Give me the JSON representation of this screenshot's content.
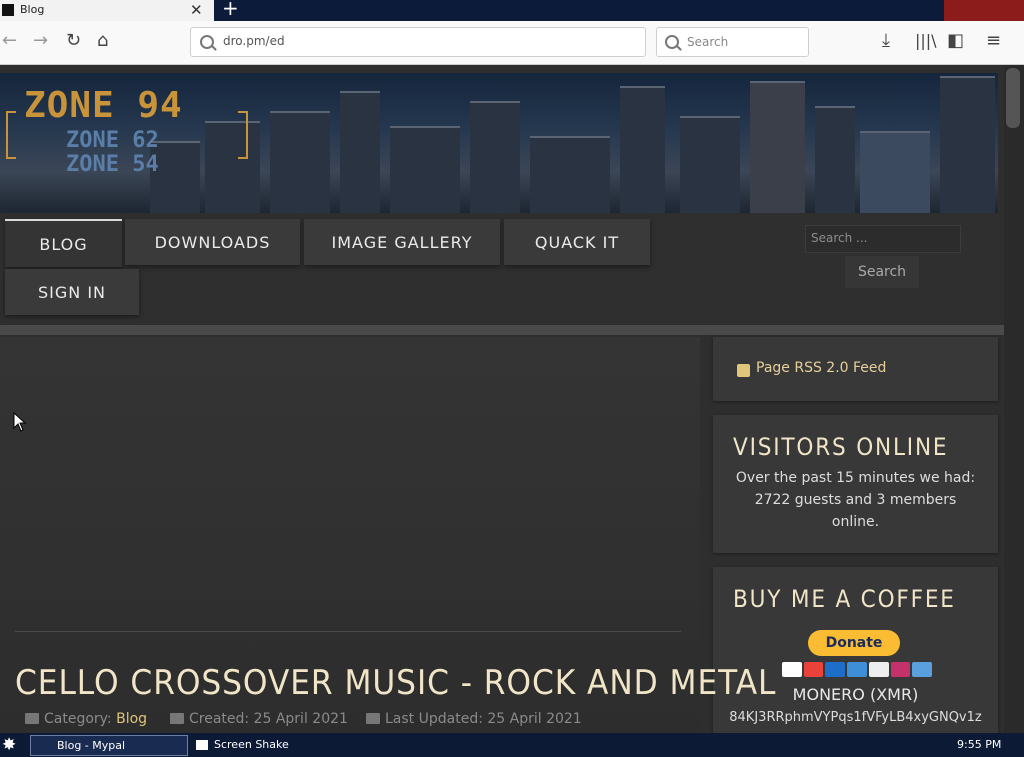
{
  "browser": {
    "tab_title": "Blog",
    "url": "dro.pm/ed",
    "search_placeholder": "Search"
  },
  "site": {
    "logo_main": "ZONE 94",
    "logo_sub1": "ZONE 62",
    "logo_sub2": "ZONE 54",
    "menu": [
      {
        "label": "BLOG"
      },
      {
        "label": "DOWNLOADS"
      },
      {
        "label": "IMAGE GALLERY"
      },
      {
        "label": "QUACK IT"
      },
      {
        "label": "SIGN IN"
      }
    ],
    "search_placeholder": "Search ...",
    "search_button": "Search"
  },
  "article": {
    "title": "CELLO CROSSOVER MUSIC - ROCK AND METAL",
    "category_label": "Category:",
    "category": "Blog",
    "created": "Created: 25 April 2021",
    "updated": "Last Updated: 25 April 2021"
  },
  "sidebar": {
    "rss": "Page RSS 2.0 Feed",
    "visitors_title": "VISITORS ONLINE",
    "visitors_line1": "Over the past 15 minutes we had:",
    "visitors_line2": "2722 guests and 3 members",
    "visitors_line3": "online.",
    "coffee_title": "BUY ME A COFFEE",
    "donate": "Donate",
    "monero_title": "MONERO (XMR)",
    "monero_addr": "84KJ3RRphmVYPqs1fVFyLB4xyGNQv1z"
  },
  "taskbar": {
    "items": [
      "Blog - Mypal",
      "Screen Shake"
    ],
    "time": "9:55 PM"
  }
}
